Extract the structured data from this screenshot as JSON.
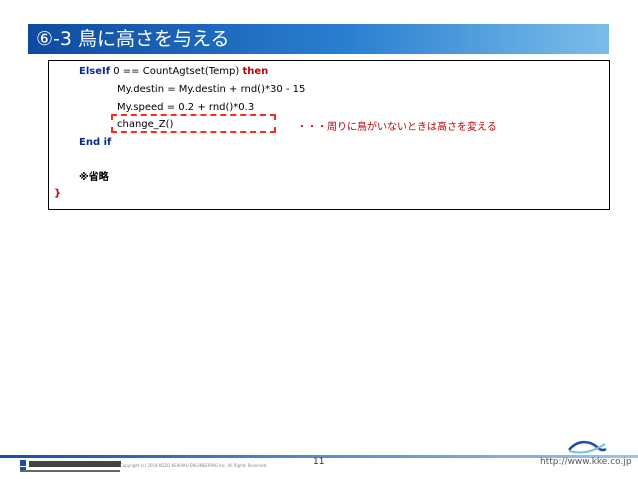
{
  "slide": {
    "title": "⑥-3 鳥に高さを与える",
    "page_number": "11",
    "url": "http://www.kke.co.jp",
    "copyright": "Copyright (c) 2018 KOZO KEIKAKU ENGINEERING Inc. All Rights Reserved.",
    "company_logo": "構造計画研究所 KOZO KEIKAKU ENGINEERING Inc."
  },
  "code": {
    "elseif_kw": "ElseIf",
    "elseif_cond": "0 == CountAgtset(Temp)",
    "then_kw": "then",
    "line2": "My.destin = My.destin + rnd()*30 - 15",
    "line3": "My.speed = 0.2 + rnd()*0.3",
    "line4": "change_Z()",
    "endif": "End if",
    "omitted": "※省略",
    "closing_brace": "}"
  },
  "annotation": {
    "comment": "・・・周りに鳥がいないときは高さを変える"
  },
  "colors": {
    "title_gradient_start": "#0e4aa0",
    "title_gradient_end": "#7bbde9",
    "keyword_blue": "#0b2c8c",
    "keyword_red": "#c00000",
    "highlight_dash": "#ff2a1a"
  }
}
